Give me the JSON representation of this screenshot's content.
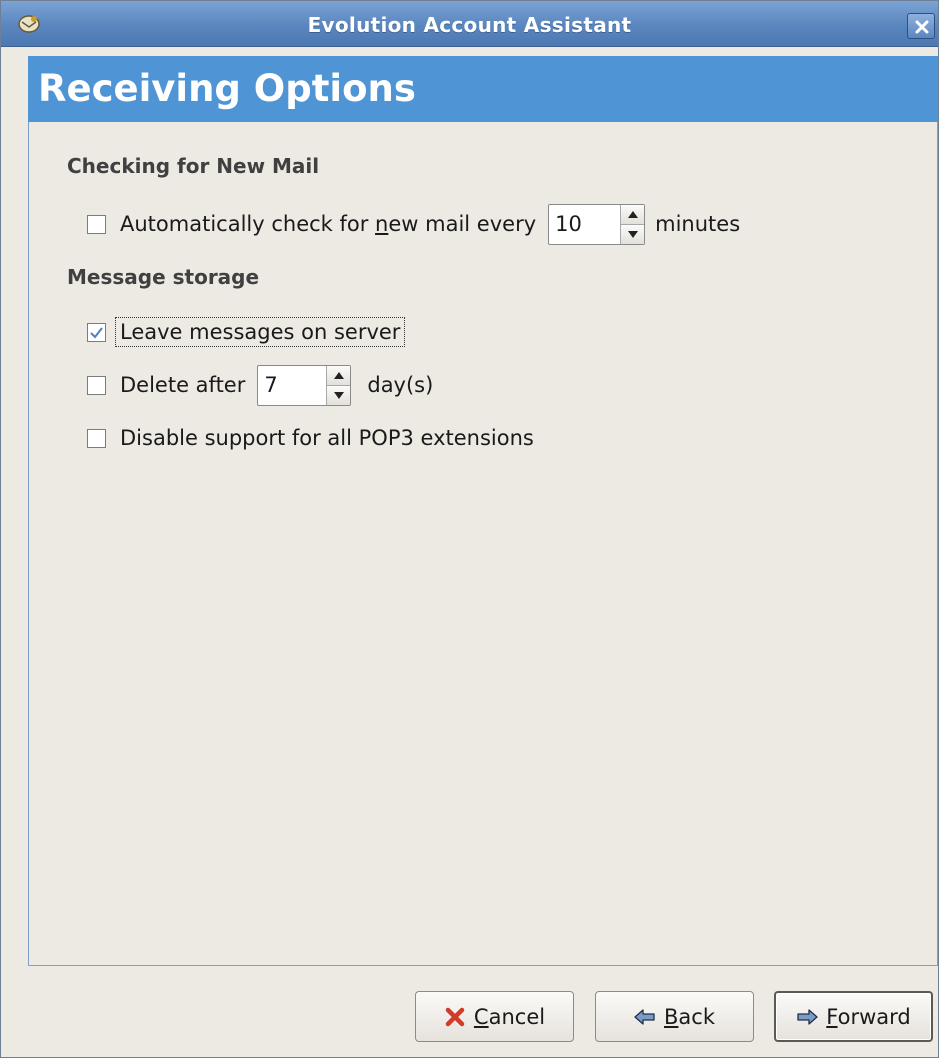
{
  "window": {
    "title": "Evolution Account Assistant",
    "icon": "evolution-app-icon",
    "close_icon": "close-icon"
  },
  "page": {
    "heading": "Receiving Options"
  },
  "sections": {
    "checking": {
      "title": "Checking for New Mail",
      "auto_check": {
        "checked": false,
        "label_before": "Automatically check for ",
        "label_mnemonic": "n",
        "label_after": "ew mail every",
        "interval_value": "10",
        "unit": "minutes"
      }
    },
    "storage": {
      "title": "Message storage",
      "leave_on_server": {
        "checked": true,
        "label": "Leave messages on server"
      },
      "delete_after": {
        "checked": false,
        "label": "Delete after",
        "value": "7",
        "unit": "day(s)"
      },
      "disable_pop3_ext": {
        "checked": false,
        "label": "Disable support for all POP3 extensions"
      }
    }
  },
  "buttons": {
    "cancel": {
      "mnemonic": "C",
      "rest": "ancel",
      "icon": "cancel-x-icon"
    },
    "back": {
      "mnemonic": "B",
      "rest": "ack",
      "icon": "back-arrow-icon"
    },
    "forward": {
      "mnemonic": "F",
      "rest": "orward",
      "icon": "forward-arrow-icon"
    }
  },
  "colors": {
    "titlebar": "#5a86bf",
    "header": "#4f94d4",
    "background": "#ede9e3",
    "cancel_icon": "#d23b2a"
  }
}
